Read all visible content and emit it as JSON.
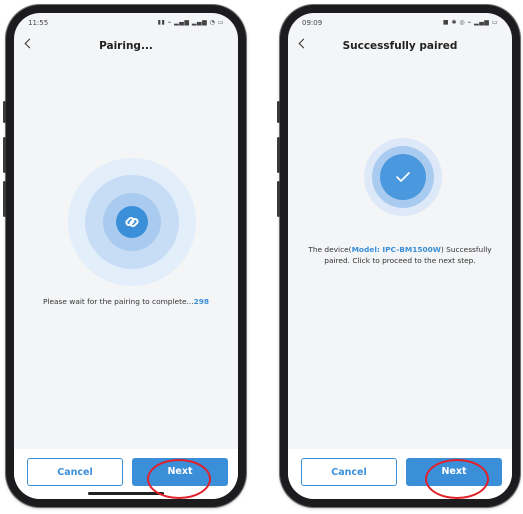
{
  "colors": {
    "accent": "#3b8fd9",
    "annotation": "#e1202a"
  },
  "left_screen": {
    "status_time": "11:55",
    "status_icons": "signal wifi battery",
    "title": "Pairing...",
    "icon": "link-icon",
    "message": "Please wait for the pairing to complete...",
    "countdown": "298",
    "cancel_label": "Cancel",
    "next_label": "Next"
  },
  "right_screen": {
    "status_time": "09:09",
    "status_icons": "signal wifi battery",
    "title": "Successfully paired",
    "icon": "check-icon",
    "message_prefix": "The device(",
    "model": "Model: IPC-BM1500W",
    "message_suffix": ") Successfully paired. Click to proceed to the next step.",
    "cancel_label": "Cancel",
    "next_label": "Next"
  }
}
